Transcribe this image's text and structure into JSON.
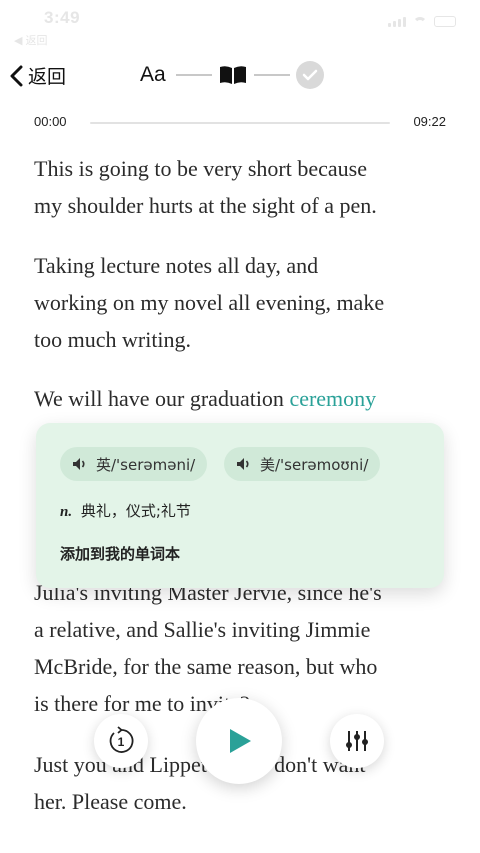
{
  "status_bar": {
    "time": "3:49",
    "back_app": "◀ 返回"
  },
  "nav": {
    "back_label": "返回",
    "steps": {
      "font_label": "Aa"
    }
  },
  "player": {
    "current_time": "00:00",
    "total_time": "09:22",
    "progress": 0
  },
  "reading": {
    "paragraphs": [
      {
        "lines": [
          "This is going to be very short because",
          "my shoulder hurts at the sight of a pen."
        ]
      },
      {
        "lines": [
          "Taking lecture notes all day, and",
          "working on my novel all evening, make",
          "too much writing."
        ]
      },
      {
        "before": "We will have our graduation ",
        "highlight": "ceremony"
      },
      {
        "lines": [
          "Julia's inviting Master Jervie, since he's",
          "a relative, and Sallie's inviting Jimmie",
          "McBride, for the same reason, but who",
          "is there for me to invite?"
        ]
      },
      {
        "lines": [
          "Just you and Lippett, and I don't want",
          "her. Please come."
        ]
      }
    ]
  },
  "word_popup": {
    "uk_pron": "英/'serəməni/",
    "us_pron": "美/'serəmoʊni/",
    "pos": "n.",
    "definition": "典礼，仪式;礼节",
    "add_label": "添加到我的单词本"
  },
  "controls": {
    "replay_seconds": "1"
  },
  "colors": {
    "accent": "#2aa198",
    "popup_bg": "#e3f4e8",
    "pill_bg": "#d0e9d8"
  }
}
